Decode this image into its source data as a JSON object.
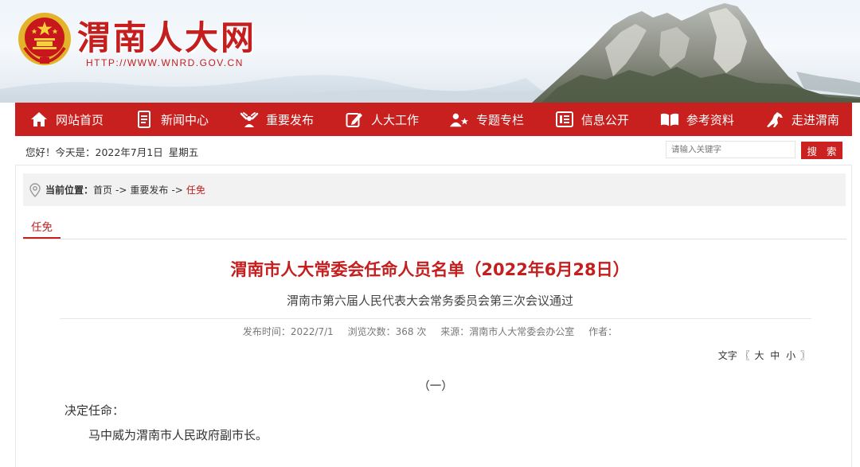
{
  "header": {
    "site_title": "渭南人大网",
    "site_url": "HTTP://WWW.WNRD.GOV.CN",
    "emblem_icon": "national-emblem-icon"
  },
  "nav": {
    "items": [
      {
        "label": "网站首页",
        "icon": "home-icon"
      },
      {
        "label": "新闻中心",
        "icon": "news-document-icon"
      },
      {
        "label": "重要发布",
        "icon": "release-person-icon"
      },
      {
        "label": "人大工作",
        "icon": "edit-icon"
      },
      {
        "label": "专题专栏",
        "icon": "person-star-icon"
      },
      {
        "label": "信息公开",
        "icon": "list-document-icon"
      },
      {
        "label": "参考资料",
        "icon": "book-icon"
      },
      {
        "label": "走进渭南",
        "icon": "horse-icon"
      }
    ],
    "bg_color": "#c81f1f"
  },
  "infobar": {
    "greeting": "您好！今天是：2022年7月1日",
    "weekday": "星期五",
    "search_placeholder": "请输入关键字",
    "search_button": "搜 索"
  },
  "breadcrumb": {
    "label": "当前位置：",
    "items": [
      "首页",
      "重要发布"
    ],
    "separator": "->",
    "current": "任免"
  },
  "category_tab": "任免",
  "article": {
    "title": "渭南市人大常委会任命人员名单（2022年6月28日）",
    "subtitle": "渭南市第六届人民代表大会常务委员会第三次会议通过",
    "publish_time": "发布时间：2022/7/1",
    "views": "浏览次数：368 次",
    "source": "来源：渭南市人大常委会办公室",
    "author": "作者：",
    "font_size_label": "文字",
    "font_size_open": "〖",
    "font_size_close": "〗",
    "font_sizes": [
      "大",
      "中",
      "小"
    ],
    "section_mark": "（一）",
    "body": [
      "决定任命：",
      "马中威为渭南市人民政府副市长。"
    ]
  },
  "colors": {
    "accent_red": "#c41e1e",
    "breadcrumb_bg": "#f2f2f2"
  }
}
